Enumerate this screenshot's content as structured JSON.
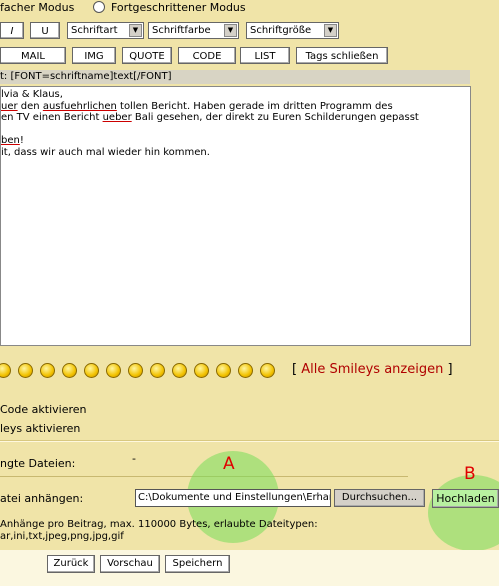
{
  "mode": {
    "simple_label": "facher Modus",
    "advanced_label": "Fortgeschrittener Modus"
  },
  "format": {
    "italic": "I",
    "underline": "U",
    "font_select": "Schriftart",
    "color_select": "Schriftfarbe",
    "size_select": "Schriftgröße",
    "mail": "MAIL",
    "img": "IMG",
    "quote": "QUOTE",
    "code": "CODE",
    "list": "LIST",
    "close_tags": "Tags schließen"
  },
  "helpline": "t: [FONT=schriftname]text[/FONT]",
  "message": {
    "line1": "lvia & Klaus,",
    "line2a": "",
    "line2_word1": "uer",
    "line2b": " den ",
    "line2_word2": "ausfuehrlichen",
    "line2c": " tollen Bericht. Haben gerade im dritten Programm des",
    "line3a": "en TV einen Bericht ",
    "line3_word": "ueber",
    "line3b": " Bali gesehen, der direkt zu Euren Schilderungen gepasst",
    "line4": "",
    "line5_word": "ben",
    "line5b": "!",
    "line6": "it, dass wir auch mal wieder hin kommen."
  },
  "smileys": {
    "icons": [
      "grin-smiley-icon",
      "smile-smiley-icon",
      "wink-smiley-icon",
      "sad-smiley-icon",
      "angry-smiley-icon",
      "eek-smiley-icon",
      "roll-smiley-icon",
      "cool-smiley-icon",
      "confused-smiley-icon",
      "frown-smiley-icon",
      "tongue-smiley-icon",
      "crazy-smiley-icon",
      "laugh-smiley-icon"
    ],
    "link_open": "[ ",
    "link_text": "Alle Smileys anzeigen",
    "link_close": " ]"
  },
  "options": {
    "bbcode": "Code aktivieren",
    "smilies": "leys aktivieren"
  },
  "attachments": {
    "attached_label": "ngte Dateien:",
    "attached_value": "-",
    "attach_label": "atei anhängen:",
    "file_path": "C:\\Dokumente und Einstellungen\\Erhard",
    "browse_button": "Durchsuchen...",
    "upload_button": "Hochladen",
    "info_line1": "Anhänge pro Beitrag, max. 110000 Bytes, erlaubte Dateitypen:",
    "info_line2": "ar,ini,txt,jpeg,png,jpg,gif"
  },
  "annotations": {
    "a": "A",
    "b": "B"
  },
  "actions": {
    "back": "Zurück",
    "preview": "Vorschau",
    "save": "Speichern"
  },
  "colors": {
    "background": "#f0e4a8",
    "annotation_red": "#e00000",
    "highlight_green": "#78dc5a",
    "link_red": "#b00000"
  }
}
